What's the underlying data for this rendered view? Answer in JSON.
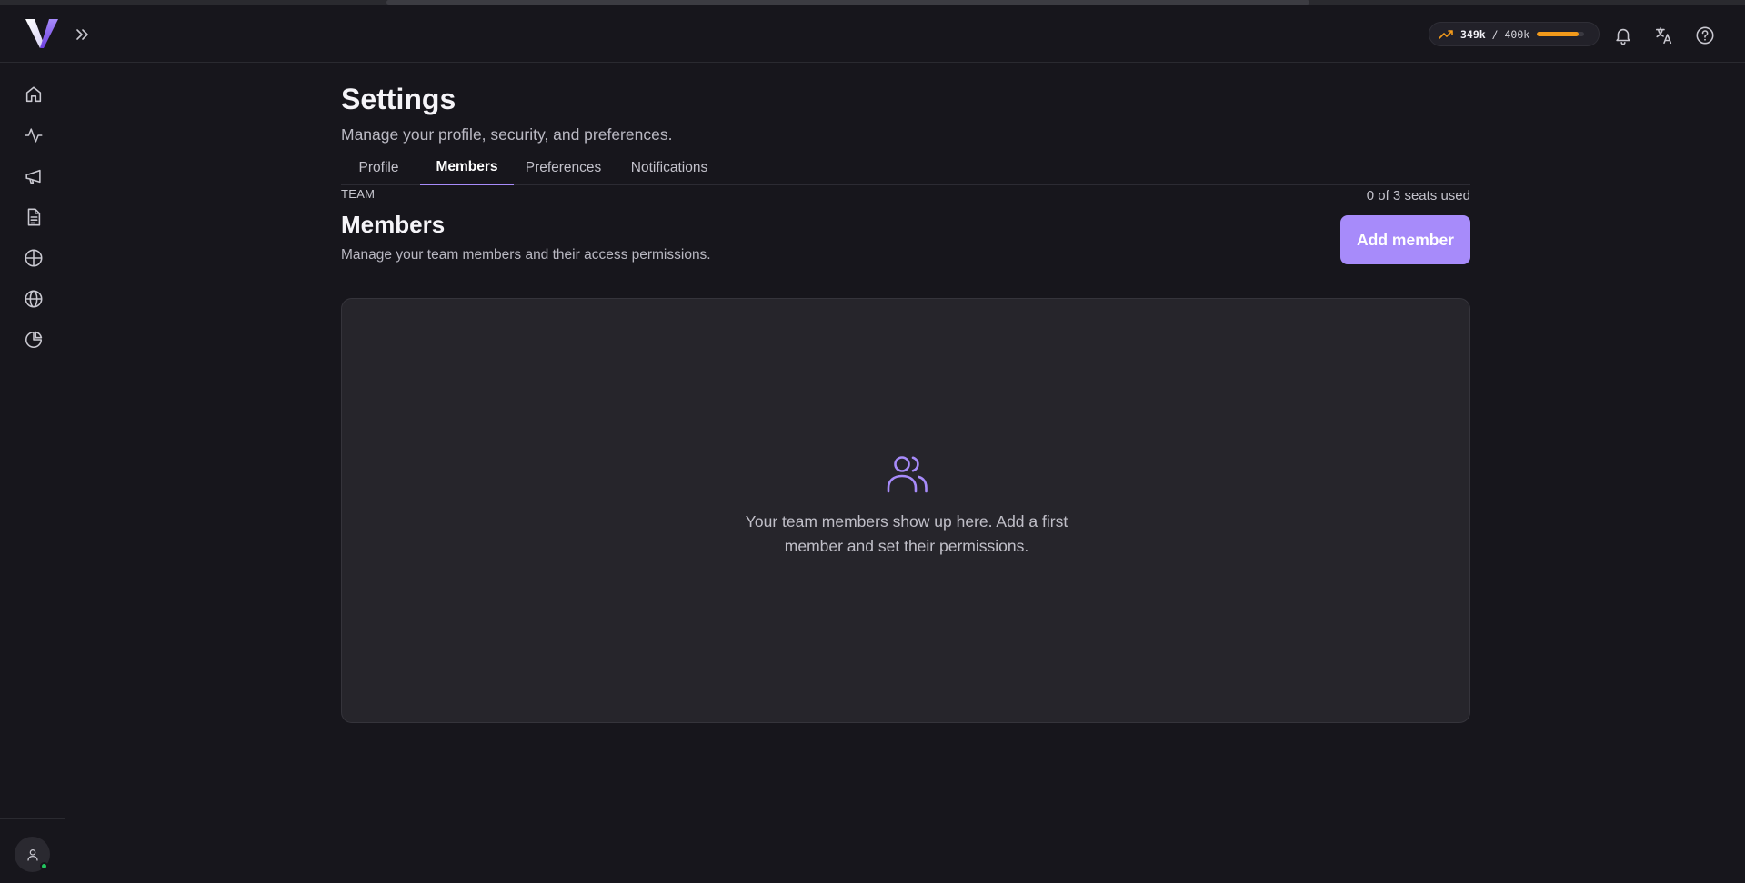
{
  "usage": {
    "used": "349k",
    "separator": " / ",
    "limit": "400k",
    "fraction": 0.8725
  },
  "header": {
    "icons": [
      "trending-up-icon",
      "bell-icon",
      "translate-icon",
      "help-icon"
    ]
  },
  "sidebar": {
    "items": [
      {
        "name": "home-icon"
      },
      {
        "name": "activity-icon"
      },
      {
        "name": "megaphone-icon"
      },
      {
        "name": "document-icon"
      },
      {
        "name": "crosshair-icon"
      },
      {
        "name": "globe-icon"
      },
      {
        "name": "pie-chart-icon"
      }
    ]
  },
  "page": {
    "title": "Settings",
    "subtitle": "Manage your profile, security, and preferences."
  },
  "tabs": [
    {
      "label": "Profile"
    },
    {
      "label": "Members",
      "active": true
    },
    {
      "label": "Preferences"
    },
    {
      "label": "Notifications"
    }
  ],
  "section": {
    "eyebrow": "TEAM",
    "seats": "0 of 3 seats used",
    "title": "Members",
    "description": "Manage your team members and their access permissions.",
    "add_button": "Add member"
  },
  "empty_state": {
    "line1": "Your team members show up here. Add a first",
    "line2": "member and set their permissions."
  },
  "colors": {
    "accent": "#a78bfa",
    "usage_bar": "#f29a1b",
    "status_online": "#22c55e",
    "background": "#17161c",
    "card": "#26252b"
  }
}
